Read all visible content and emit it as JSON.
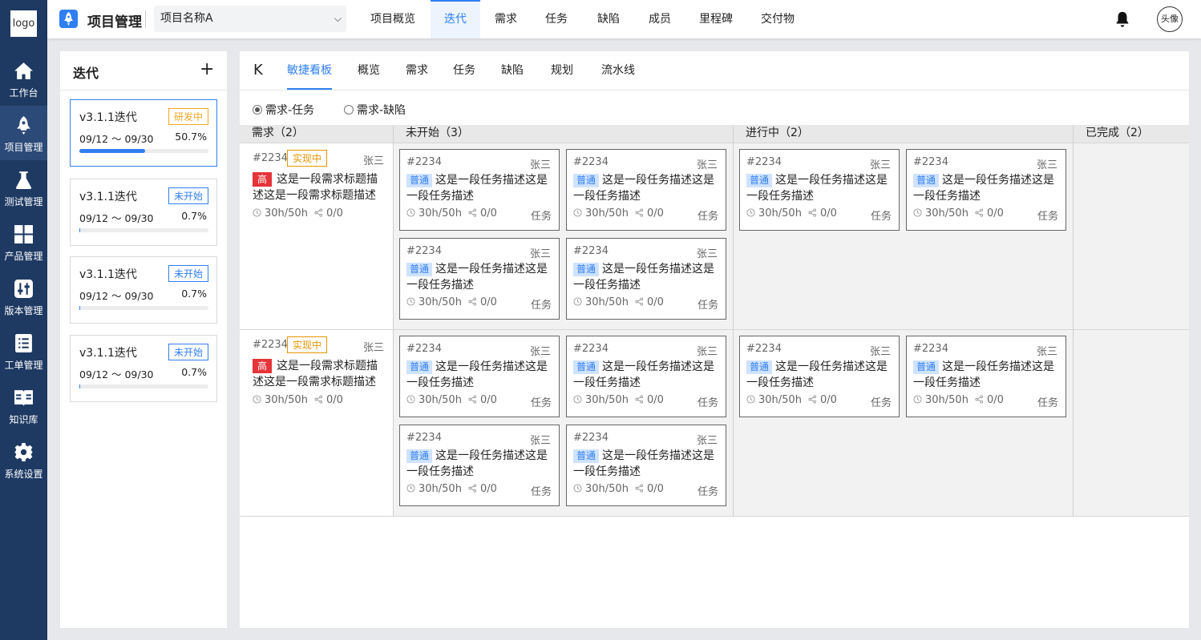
{
  "nav": {
    "logo": "logo",
    "items": [
      {
        "label": "工作台",
        "icon": "home-icon"
      },
      {
        "label": "项目管理",
        "icon": "rocket-icon"
      },
      {
        "label": "测试管理",
        "icon": "flask-icon"
      },
      {
        "label": "产品管理",
        "icon": "grid-icon"
      },
      {
        "label": "版本管理",
        "icon": "sliders-icon"
      },
      {
        "label": "工单管理",
        "icon": "list-icon"
      },
      {
        "label": "知识库",
        "icon": "book-icon"
      },
      {
        "label": "系统设置",
        "icon": "gear-icon"
      }
    ]
  },
  "topbar": {
    "title": "项目管理",
    "project_select": "项目名称A",
    "tabs": [
      "项目概览",
      "迭代",
      "需求",
      "任务",
      "缺陷",
      "成员",
      "里程碑",
      "交付物"
    ],
    "active_tab": "迭代",
    "avatar": "头像",
    "accent": "#2f7ff3"
  },
  "iterations": {
    "title": "迭代",
    "add": "+",
    "items": [
      {
        "name": "v3.1.1迭代",
        "status": "研发中",
        "dates": "09/12 ～ 09/30",
        "percent": "50.7%",
        "progress": 0.507
      },
      {
        "name": "v3.1.1迭代",
        "status": "未开始",
        "dates": "09/12 ～ 09/30",
        "percent": "0.7%",
        "progress": 0.007
      },
      {
        "name": "v3.1.1迭代",
        "status": "未开始",
        "dates": "09/12 ～ 09/30",
        "percent": "0.7%",
        "progress": 0.007
      },
      {
        "name": "v3.1.1迭代",
        "status": "未开始",
        "dates": "09/12 ～ 09/30",
        "percent": "0.7%",
        "progress": 0.007
      }
    ]
  },
  "main": {
    "back": "K",
    "tabs": [
      "敏捷看板",
      "概览",
      "需求",
      "任务",
      "缺陷",
      "规划",
      "流水线"
    ],
    "active_tab": "敏捷看板",
    "radios": [
      {
        "label": "需求-任务",
        "checked": true
      },
      {
        "label": "需求-缺陷",
        "checked": false
      }
    ]
  },
  "board": {
    "columns": [
      "需求（2）",
      "未开始（3）",
      "进行中（2）",
      "已完成（2）"
    ],
    "rows": [
      {
        "req": {
          "id": "#2234",
          "badge": "实现中",
          "owner": "张三",
          "priority": "高",
          "text": "这是一段需求标题描述这是一段需求标题描述",
          "hours": "30h/50h",
          "links": "0/0"
        },
        "todo": [
          {
            "id": "#2234",
            "owner": "张三",
            "type": "普通",
            "text": "这是一段任务描述这是一段任务描述",
            "hours": "30h/50h",
            "links": "0/0",
            "kind": "任务"
          },
          {
            "id": "#2234",
            "owner": "张三",
            "type": "普通",
            "text": "这是一段任务描述这是一段任务描述",
            "hours": "30h/50h",
            "links": "0/0",
            "kind": "任务"
          },
          {
            "id": "#2234",
            "owner": "张三",
            "type": "普通",
            "text": "这是一段任务描述这是一段任务描述",
            "hours": "30h/50h",
            "links": "0/0",
            "kind": "任务"
          },
          {
            "id": "#2234",
            "owner": "张三",
            "type": "普通",
            "text": "这是一段任务描述这是一段任务描述",
            "hours": "30h/50h",
            "links": "0/0",
            "kind": "任务"
          }
        ],
        "doing": [
          {
            "id": "#2234",
            "owner": "张三",
            "type": "普通",
            "text": "这是一段任务描述这是一段任务描述",
            "hours": "30h/50h",
            "links": "0/0",
            "kind": "任务"
          },
          {
            "id": "#2234",
            "owner": "张三",
            "type": "普通",
            "text": "这是一段任务描述这是一段任务描述",
            "hours": "30h/50h",
            "links": "0/0",
            "kind": "任务"
          }
        ]
      },
      {
        "req": {
          "id": "#2234",
          "badge": "实现中",
          "owner": "张三",
          "priority": "高",
          "text": "这是一段需求标题描述这是一段需求标题描述",
          "hours": "30h/50h",
          "links": "0/0"
        },
        "todo": [
          {
            "id": "#2234",
            "owner": "张三",
            "type": "普通",
            "text": "这是一段任务描述这是一段任务描述",
            "hours": "30h/50h",
            "links": "0/0",
            "kind": "任务"
          },
          {
            "id": "#2234",
            "owner": "张三",
            "type": "普通",
            "text": "这是一段任务描述这是一段任务描述",
            "hours": "30h/50h",
            "links": "0/0",
            "kind": "任务"
          },
          {
            "id": "#2234",
            "owner": "张三",
            "type": "普通",
            "text": "这是一段任务描述这是一段任务描述",
            "hours": "30h/50h",
            "links": "0/0",
            "kind": "任务"
          },
          {
            "id": "#2234",
            "owner": "张三",
            "type": "普通",
            "text": "这是一段任务描述这是一段任务描述",
            "hours": "30h/50h",
            "links": "0/0",
            "kind": "任务"
          }
        ],
        "doing": [
          {
            "id": "#2234",
            "owner": "张三",
            "type": "普通",
            "text": "这是一段任务描述这是一段任务描述",
            "hours": "30h/50h",
            "links": "0/0",
            "kind": "任务"
          },
          {
            "id": "#2234",
            "owner": "张三",
            "type": "普通",
            "text": "这是一段任务描述这是一段任务描述",
            "hours": "30h/50h",
            "links": "0/0",
            "kind": "任务"
          }
        ]
      }
    ]
  }
}
